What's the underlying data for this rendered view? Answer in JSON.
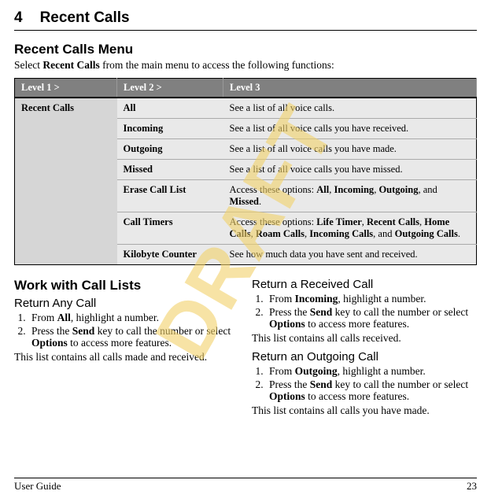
{
  "watermark": "DRAFT",
  "chapter": {
    "number": "4",
    "title": "Recent Calls"
  },
  "section": {
    "heading": "Recent Calls Menu",
    "intro_pre": "Select ",
    "intro_bold": "Recent Calls",
    "intro_post": " from the main menu to access the following functions:"
  },
  "table": {
    "headers": [
      "Level 1 >",
      "Level 2 >",
      "Level 3"
    ],
    "group": "Recent Calls",
    "rows": [
      {
        "lvl2": "All",
        "desc": "See a list of all voice calls."
      },
      {
        "lvl2": "Incoming",
        "desc": "See a list of all voice calls you have received."
      },
      {
        "lvl2": "Outgoing",
        "desc": "See a list of all voice calls you have made."
      },
      {
        "lvl2": "Missed",
        "desc": "See a list of all voice calls you have missed."
      },
      {
        "lvl2": "Erase Call List",
        "desc_html": "Access these options: <b>All</b>, <b>Incoming</b>, <b>Outgoing</b>, and <b>Missed</b>."
      },
      {
        "lvl2": "Call Timers",
        "desc_html": "Access these options: <b>Life Timer</b>, <b>Recent Calls</b>, <b>Home Calls</b>, <b>Roam Calls</b>, <b>Incoming Calls</b>, and <b>Outgoing Calls</b>."
      },
      {
        "lvl2": "Kilobyte Counter",
        "desc": "See how much data you have sent and received."
      }
    ]
  },
  "left": {
    "heading": "Work with Call Lists",
    "topic1": {
      "title": "Return Any Call",
      "step1_html": "From <b>All</b>, highlight a number.",
      "step2_html": "Press the <b>Send</b> key to call the number or select <b>Options</b> to access more features.",
      "note": "This list contains all calls made and received."
    }
  },
  "right": {
    "topic1": {
      "title": "Return a Received Call",
      "step1_html": "From <b>Incoming</b>, highlight a number.",
      "step2_html": "Press the <b>Send</b> key to call the number or select <b>Options</b> to access more features.",
      "note": "This list contains all calls received."
    },
    "topic2": {
      "title": "Return an Outgoing Call",
      "step1_html": "From <b>Outgoing</b>, highlight a number.",
      "step2_html": "Press the <b>Send</b> key to call the number or select <b>Options</b> to access more features.",
      "note": "This list contains all calls you have made."
    }
  },
  "footer": {
    "left": "User Guide",
    "right": "23"
  }
}
